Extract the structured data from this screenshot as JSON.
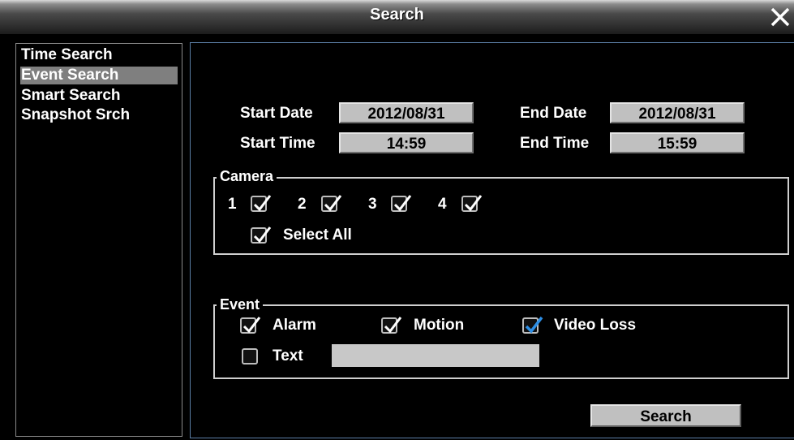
{
  "window": {
    "title": "Search"
  },
  "sidebar": {
    "items": [
      {
        "label": "Time Search",
        "selected": false
      },
      {
        "label": "Event Search",
        "selected": true
      },
      {
        "label": "Smart Search",
        "selected": false
      },
      {
        "label": "Snapshot Srch",
        "selected": false
      }
    ]
  },
  "form": {
    "start_date_label": "Start Date",
    "start_date": "2012/08/31",
    "end_date_label": "End Date",
    "end_date": "2012/08/31",
    "start_time_label": "Start Time",
    "start_time": "14:59",
    "end_time_label": "End Time",
    "end_time": "15:59"
  },
  "camera": {
    "legend": "Camera",
    "cams": [
      {
        "label": "1",
        "checked": true
      },
      {
        "label": "2",
        "checked": true
      },
      {
        "label": "3",
        "checked": true
      },
      {
        "label": "4",
        "checked": true
      }
    ],
    "select_all": {
      "label": "Select All",
      "checked": true
    }
  },
  "event": {
    "legend": "Event",
    "alarm": {
      "label": "Alarm",
      "checked": true
    },
    "motion": {
      "label": "Motion",
      "checked": true
    },
    "video_loss": {
      "label": "Video Loss",
      "checked": true
    },
    "text": {
      "label": "Text",
      "checked": false,
      "value": ""
    }
  },
  "actions": {
    "search_label": "Search"
  },
  "colors": {
    "panel_border": "#5c7fa6",
    "selected_bg": "#7f7f7f",
    "video_loss_check": "#2d8fe6"
  }
}
